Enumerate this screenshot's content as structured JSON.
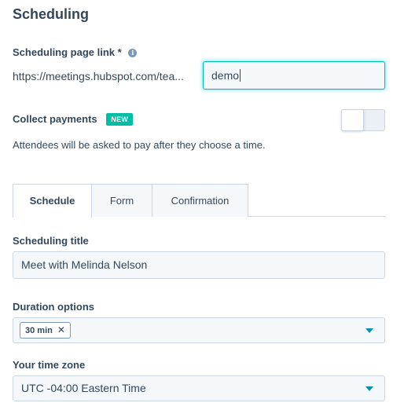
{
  "page": {
    "title": "Scheduling"
  },
  "link": {
    "label": "Scheduling page link",
    "required_mark": "*",
    "info_icon": "info-icon",
    "url_prefix": "https://meetings.hubspot.com/tea...",
    "slug_value": "demo"
  },
  "payments": {
    "label": "Collect payments",
    "badge": "NEW",
    "toggle_on": false,
    "description": "Attendees will be asked to pay after they choose a time."
  },
  "tabs": [
    {
      "label": "Schedule",
      "active": true
    },
    {
      "label": "Form",
      "active": false
    },
    {
      "label": "Confirmation",
      "active": false
    }
  ],
  "scheduling_title": {
    "label": "Scheduling title",
    "value": "Meet with Melinda Nelson"
  },
  "duration": {
    "label": "Duration options",
    "chips": [
      {
        "label": "30 min",
        "remove_icon": "close-icon"
      }
    ]
  },
  "timezone": {
    "label": "Your time zone",
    "value": "UTC -04:00 Eastern Time"
  },
  "colors": {
    "accent": "#00bda5",
    "caret": "#0091ae",
    "text": "#33475b",
    "border": "#cbd6e2"
  }
}
